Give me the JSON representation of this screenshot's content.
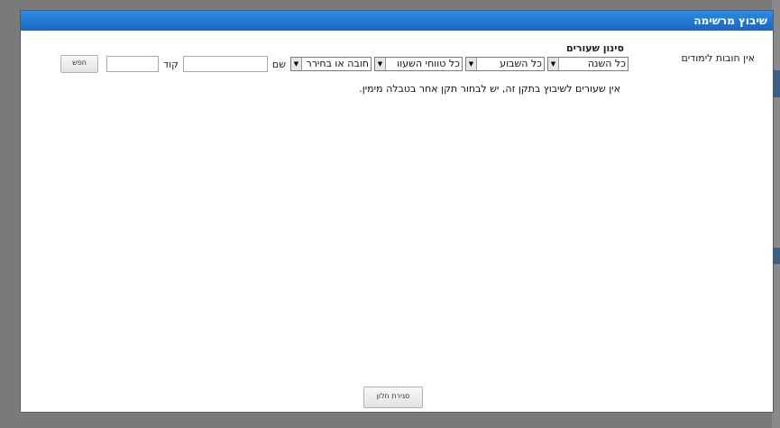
{
  "dialog": {
    "title": "שיבוץ מרשימה",
    "no_requirements": "אין חובות לימודים",
    "filter_title": "סינון שעורים",
    "filters": {
      "year": "כל השנה",
      "week": "כל השבוע",
      "hours": "כל טווחי השעוו",
      "type": "חובה או בחירר"
    },
    "name_label": "שם",
    "code_label": "קוד",
    "name_value": "",
    "code_value": "",
    "search_button": "חפש",
    "message": "אין שעורים לשיבוץ בתקן זה, יש לבחור תקן אחר בטבלה מימין.",
    "close_button": "סגירת חלון"
  }
}
